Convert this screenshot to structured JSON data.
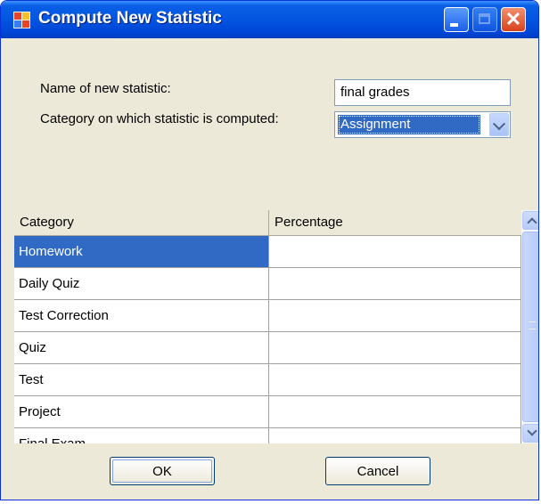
{
  "window": {
    "title": "Compute New Statistic",
    "controls": [
      "minimize",
      "maximize",
      "close"
    ]
  },
  "form": {
    "name_label": "Name of new statistic:",
    "name_value": "final grades",
    "category_label": "Category on which statistic is computed:",
    "category_selected": "Assignment"
  },
  "grid": {
    "columns": [
      "Category",
      "Percentage"
    ],
    "rows": [
      {
        "category": "Homework",
        "percentage": "",
        "selected": true
      },
      {
        "category": "Daily Quiz",
        "percentage": ""
      },
      {
        "category": "Test Correction",
        "percentage": ""
      },
      {
        "category": "Quiz",
        "percentage": ""
      },
      {
        "category": "Test",
        "percentage": ""
      },
      {
        "category": "Project",
        "percentage": ""
      },
      {
        "category": "Final Exam",
        "percentage": ""
      }
    ]
  },
  "buttons": {
    "ok": "OK",
    "cancel": "Cancel"
  },
  "colors": {
    "titlebar": "#0255e0",
    "selection": "#316ac5",
    "dialog_bg": "#ece9d8"
  }
}
